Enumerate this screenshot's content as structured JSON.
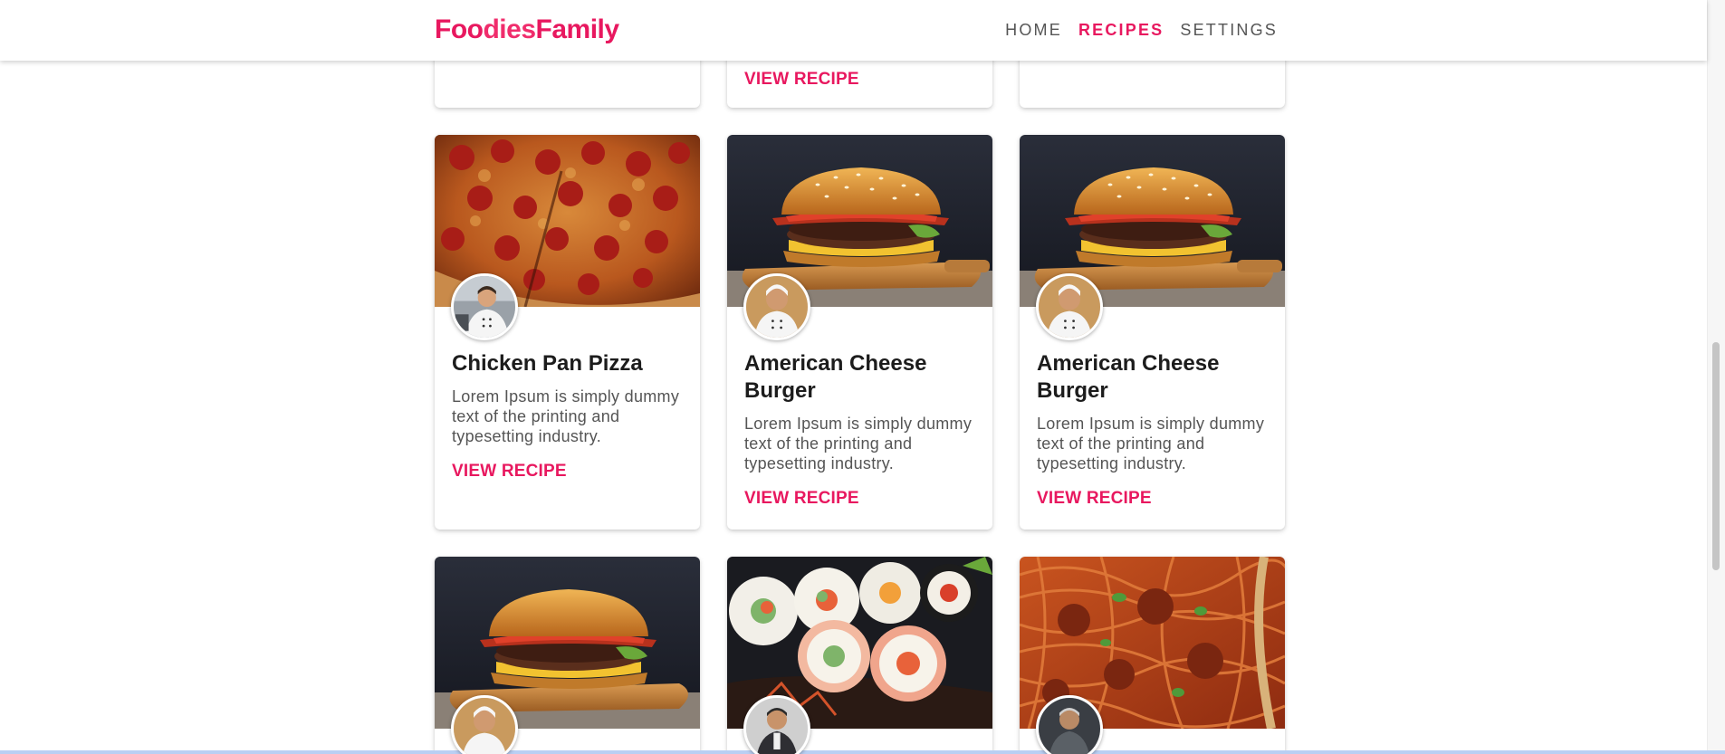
{
  "brand": {
    "prefix": "Foo",
    "middle": "dies",
    "suffix": "Family"
  },
  "nav": {
    "items": [
      "HOME",
      "RECIPES",
      "SETTINGS"
    ],
    "active": "RECIPES"
  },
  "top_row": {
    "link": "VIEW RECIPE"
  },
  "cards": [
    {
      "title": "Chicken Pan Pizza",
      "desc": "Lorem Ipsum is simply dummy text of the printing and typesetting industry.",
      "link": "VIEW RECIPE",
      "image": "pizza"
    },
    {
      "title": "American Cheese Burger",
      "desc": "Lorem Ipsum is simply dummy text of the printing and typesetting industry.",
      "link": "VIEW RECIPE",
      "image": "burger"
    },
    {
      "title": "American Cheese Burger",
      "desc": "Lorem Ipsum is simply dummy text of the printing and typesetting industry.",
      "link": "VIEW RECIPE",
      "image": "burger"
    }
  ],
  "bottom_row": [
    {
      "image": "burger"
    },
    {
      "image": "sushi"
    },
    {
      "image": "spaghetti"
    }
  ],
  "colors": {
    "accent": "#e8185f",
    "text": "#1c1c1c",
    "muted": "#555555"
  }
}
